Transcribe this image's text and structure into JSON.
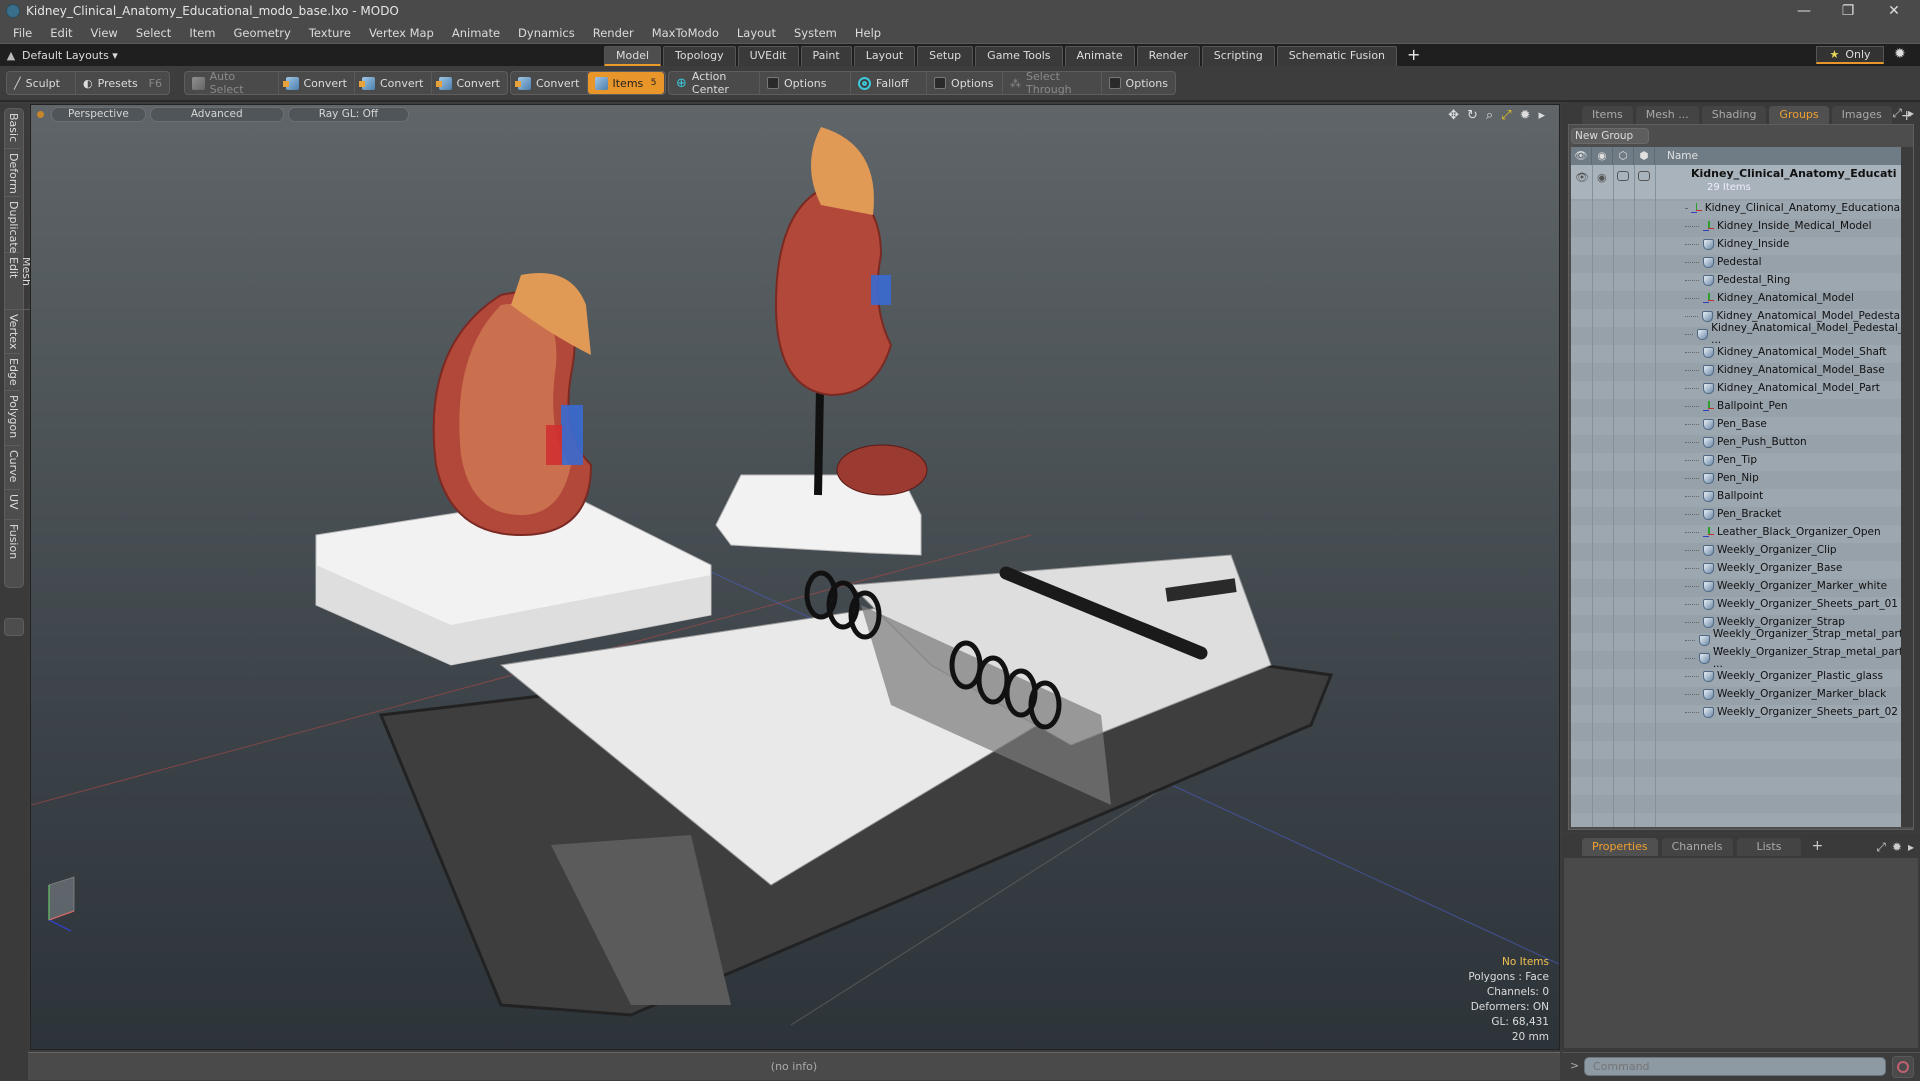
{
  "window": {
    "title": "Kidney_Clinical_Anatomy_Educational_modo_base.lxo - MODO",
    "controls": {
      "minimize": "—",
      "restore": "❐",
      "close": "✕"
    }
  },
  "menu": [
    "File",
    "Edit",
    "View",
    "Select",
    "Item",
    "Geometry",
    "Texture",
    "Vertex Map",
    "Animate",
    "Dynamics",
    "Render",
    "MaxToModo",
    "Layout",
    "System",
    "Help"
  ],
  "layout_bar": {
    "layouts_label": "Default Layouts ▾",
    "tabs": [
      "Model",
      "Topology",
      "UVEdit",
      "Paint",
      "Layout",
      "Setup",
      "Game Tools",
      "Animate",
      "Render",
      "Scripting",
      "Schematic Fusion"
    ],
    "active_tab": "Model",
    "add_tab": "+",
    "only_label": "Only",
    "star": "★",
    "gear": "✹"
  },
  "toolbar": {
    "sculpt": "Sculpt",
    "presets": "Presets",
    "presets_hint": "F6",
    "auto_select": "Auto Select",
    "convert1": "Convert",
    "convert2": "Convert",
    "convert3": "Convert",
    "convert4": "Convert",
    "items": "Items",
    "items_count": "5",
    "action_center": "Action Center",
    "options1": "Options",
    "falloff": "Falloff",
    "options2": "Options",
    "select_through": "Select Through",
    "options3": "Options"
  },
  "left_tabs": [
    "Basic",
    "Deform",
    "Duplicate",
    "Mesh Edit",
    "Vertex",
    "Edge",
    "Polygon",
    "Curve",
    "UV",
    "Fusion"
  ],
  "viewport": {
    "view_mode": "Perspective",
    "shading": "Advanced",
    "raygl": "Ray GL: Off",
    "tools": {
      "move": "✥",
      "rotate": "↻",
      "zoom": "⌕",
      "maximize": "⤢",
      "settings": "✹",
      "more": "▸"
    },
    "stats": {
      "selection": "No Items",
      "polygons": "Polygons : Face",
      "channels": "Channels: 0",
      "deformers": "Deformers: ON",
      "gl": "GL: 68,431",
      "scale": "20 mm"
    }
  },
  "status_bar": {
    "info": "(no info)"
  },
  "right_panel": {
    "tabs": [
      "Items",
      "Mesh ...",
      "Shading",
      "Groups",
      "Images"
    ],
    "active_tab": "Groups",
    "add_tab": "+",
    "new_group": "New Group",
    "column_name": "Name",
    "root": {
      "name": "Kidney_Clinical_Anatomy_Educati ...",
      "count": "29 Items"
    },
    "items": [
      {
        "name": "Kidney_Clinical_Anatomy_Educational",
        "type": "locator"
      },
      {
        "name": "Kidney_Inside_Medical_Model",
        "type": "locator"
      },
      {
        "name": "Kidney_Inside",
        "type": "mesh"
      },
      {
        "name": "Pedestal",
        "type": "mesh"
      },
      {
        "name": "Pedestal_Ring",
        "type": "mesh"
      },
      {
        "name": "Kidney_Anatomical_Model",
        "type": "locator"
      },
      {
        "name": "Kidney_Anatomical_Model_Pedestal",
        "type": "mesh"
      },
      {
        "name": "Kidney_Anatomical_Model_Pedestal_ ...",
        "type": "mesh"
      },
      {
        "name": "Kidney_Anatomical_Model_Shaft",
        "type": "mesh"
      },
      {
        "name": "Kidney_Anatomical_Model_Base",
        "type": "mesh"
      },
      {
        "name": "Kidney_Anatomical_Model_Part",
        "type": "mesh"
      },
      {
        "name": "Ballpoint_Pen",
        "type": "locator"
      },
      {
        "name": "Pen_Base",
        "type": "mesh"
      },
      {
        "name": "Pen_Push_Button",
        "type": "mesh"
      },
      {
        "name": "Pen_Tip",
        "type": "mesh"
      },
      {
        "name": "Pen_Nip",
        "type": "mesh"
      },
      {
        "name": "Ballpoint",
        "type": "mesh"
      },
      {
        "name": "Pen_Bracket",
        "type": "mesh"
      },
      {
        "name": "Leather_Black_Organizer_Open",
        "type": "locator"
      },
      {
        "name": "Weekly_Organizer_Clip",
        "type": "mesh"
      },
      {
        "name": "Weekly_Organizer_Base",
        "type": "mesh"
      },
      {
        "name": "Weekly_Organizer_Marker_white",
        "type": "mesh"
      },
      {
        "name": "Weekly_Organizer_Sheets_part_01",
        "type": "mesh"
      },
      {
        "name": "Weekly_Organizer_Strap",
        "type": "mesh"
      },
      {
        "name": "Weekly_Organizer_Strap_metal_part ...",
        "type": "mesh"
      },
      {
        "name": "Weekly_Organizer_Strap_metal_part ...",
        "type": "mesh"
      },
      {
        "name": "Weekly_Organizer_Plastic_glass",
        "type": "mesh"
      },
      {
        "name": "Weekly_Organizer_Marker_black",
        "type": "mesh"
      },
      {
        "name": "Weekly_Organizer_Sheets_part_02",
        "type": "mesh"
      }
    ]
  },
  "properties_panel": {
    "tabs": [
      "Properties",
      "Channels",
      "Lists"
    ],
    "active_tab": "Properties",
    "add_tab": "+"
  },
  "command": {
    "prompt": ">",
    "placeholder": "Command"
  },
  "colors": {
    "accent": "#e8962a",
    "tab_active_text": "#f0a030",
    "stats_highlight": "#f0c050"
  }
}
